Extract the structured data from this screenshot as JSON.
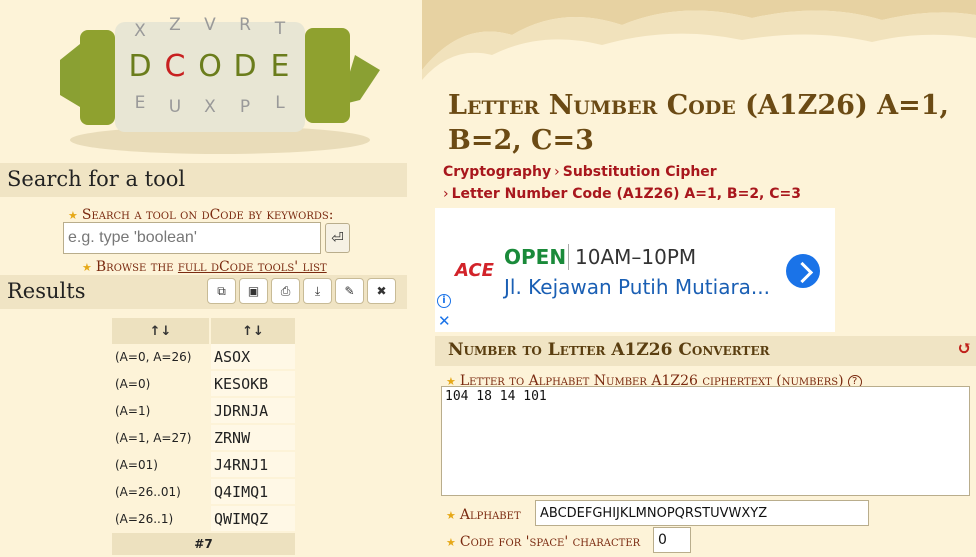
{
  "logo": {
    "letters": [
      "D",
      "C",
      "O",
      "D",
      "E"
    ]
  },
  "search": {
    "heading": "Search for a tool",
    "hint": "Search a tool on dCode by keywords:",
    "placeholder": "e.g. type 'boolean'",
    "go_icon": "enter-icon",
    "browse_prefix": "Browse the ",
    "browse_link": "full dCode tools' list"
  },
  "results": {
    "heading": "Results",
    "toolbar_icons": [
      "copy-icon",
      "save-icon",
      "print-icon",
      "download-icon",
      "pin-icon",
      "close-icon"
    ],
    "headers": [
      "↑↓",
      "↑↓"
    ],
    "rows": [
      {
        "key": "(A=0, A=26)",
        "value": "ASOX"
      },
      {
        "key": "(A=0)",
        "value": "KESOKB"
      },
      {
        "key": "(A=1)",
        "value": "JDRNJA"
      },
      {
        "key": "(A=1, A=27)",
        "value": "ZRNW"
      },
      {
        "key": "(A=01)",
        "value": "J4RNJ1"
      },
      {
        "key": "(A=26..01)",
        "value": "Q4IMQ1"
      },
      {
        "key": "(A=26..1)",
        "value": "QWIMQZ"
      }
    ],
    "footer": "#7"
  },
  "page": {
    "title": "Letter Number Code (A1Z26) A=1, B=2, C=3",
    "crumbs": [
      "Cryptography",
      "Substitution Cipher",
      "Letter Number Code (A1Z26) A=1, B=2, C=3"
    ]
  },
  "ad": {
    "brand": "ACE",
    "status": "OPEN",
    "hours": "10AM–10PM",
    "address": "Jl. Kejawan Putih Mutiara...",
    "colors": {
      "open": "#1a8a3a",
      "address": "#1a5fb4",
      "brand": "#d2232a",
      "directions": "#1a73e8"
    }
  },
  "converter": {
    "heading": "Number to Letter A1Z26 Converter",
    "cipher_label": "Letter to Alphabet Number A1Z26 ciphertext (numbers)",
    "cipher_value": "104 18 14 101",
    "alphabet_label": "Alphabet",
    "alphabet_value": "ABCDEFGHIJKLMNOPQRSTUVWXYZ",
    "space_label": "Code for 'space' character",
    "space_value": "0"
  },
  "colors": {
    "background": "#fdf3d8",
    "section_header": "#f0e4c4",
    "title": "#6b4a14",
    "link": "#a8171d",
    "label": "#7a2a10"
  }
}
